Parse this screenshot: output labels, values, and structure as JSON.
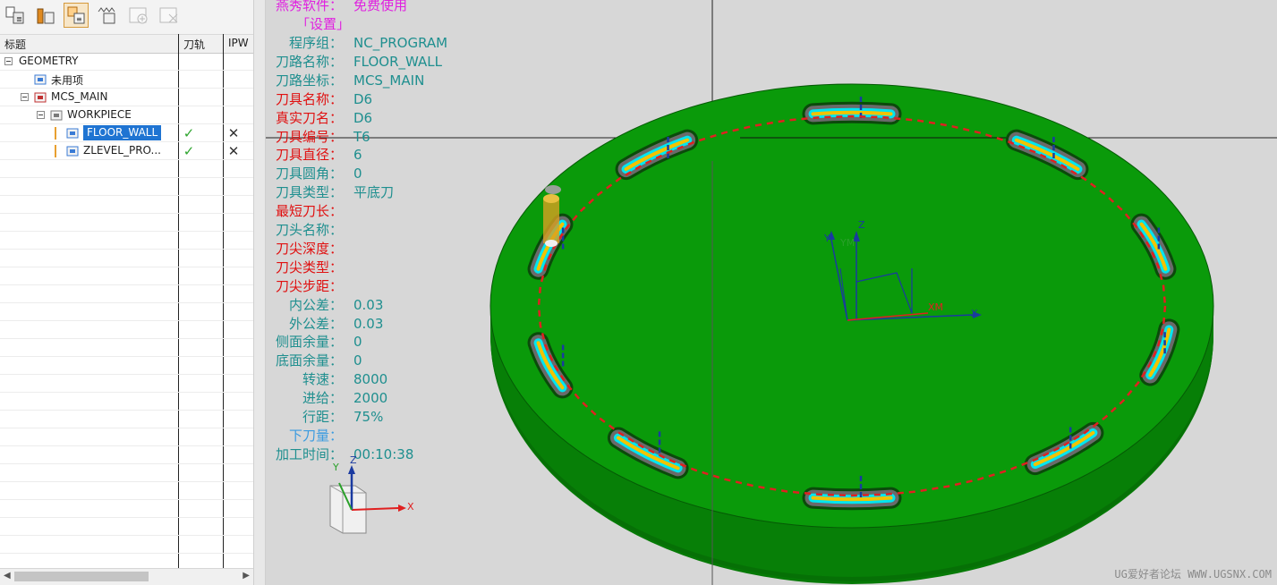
{
  "navigator": {
    "toolbar": [
      {
        "name": "program-order-view-button",
        "icon": "program-order-icon"
      },
      {
        "name": "machine-tool-view-button",
        "icon": "machine-tool-icon"
      },
      {
        "name": "geometry-view-button",
        "icon": "geometry-view-icon",
        "active": true
      },
      {
        "name": "machining-method-view-button",
        "icon": "machining-method-icon"
      },
      {
        "name": "add-object-button",
        "icon": "add-object-icon",
        "disabled": true
      },
      {
        "name": "delete-object-button",
        "icon": "delete-object-icon",
        "disabled": true
      }
    ],
    "columns": {
      "name": "标题",
      "toolpath": "刀轨",
      "ipw": "IPW"
    },
    "tree": [
      {
        "label": "GEOMETRY",
        "level": 0,
        "expander": true
      },
      {
        "label": "未用项",
        "level": 1
      },
      {
        "label": "MCS_MAIN",
        "level": 1,
        "expander": true
      },
      {
        "label": "WORKPIECE",
        "level": 2,
        "expander": true
      },
      {
        "label": "FLOOR_WALL",
        "level": 3,
        "selected": true,
        "toolpath": "✓",
        "ipw": "✕"
      },
      {
        "label": "ZLEVEL_PRO...",
        "level": 3,
        "toolpath": "✓",
        "ipw": "✕"
      }
    ]
  },
  "viewport": {
    "header": {
      "key": "燕秀软件：",
      "value": "免费使用"
    },
    "settings_label": "「设置」",
    "params": [
      {
        "key": "程序组：",
        "value": "NC_PROGRAM",
        "color": "#1f8f8f"
      },
      {
        "key": "刀路名称：",
        "value": "FLOOR_WALL",
        "color": "#1f8f8f"
      },
      {
        "key": "刀路坐标：",
        "value": "MCS_MAIN",
        "color": "#1f8f8f"
      },
      {
        "key": "刀具名称：",
        "value": "D6",
        "color": "#e01010"
      },
      {
        "key": "真实刀名：",
        "value": "D6",
        "color": "#e01010"
      },
      {
        "key": "刀具编号：",
        "value": "T6",
        "color": "#e01010"
      },
      {
        "key": "刀具直径：",
        "value": "6",
        "color": "#e01010"
      },
      {
        "key": "刀具圆角：",
        "value": "0",
        "color": "#1f8f8f"
      },
      {
        "key": "刀具类型：",
        "value": "平底刀",
        "color": "#1f8f8f"
      },
      {
        "key": "最短刀长：",
        "value": "",
        "color": "#e01010"
      },
      {
        "key": "刀头名称：",
        "value": "",
        "color": "#1f8f8f"
      },
      {
        "key": "刀尖深度：",
        "value": "",
        "color": "#e01010"
      },
      {
        "key": "刀尖类型：",
        "value": "",
        "color": "#e01010"
      },
      {
        "key": "刀尖步距：",
        "value": "",
        "color": "#e01010"
      },
      {
        "key": "内公差：",
        "value": "0.03",
        "color": "#1f8f8f"
      },
      {
        "key": "外公差：",
        "value": "0.03",
        "color": "#1f8f8f"
      },
      {
        "key": "侧面余量：",
        "value": "0",
        "color": "#1f8f8f"
      },
      {
        "key": "底面余量：",
        "value": "0",
        "color": "#1f8f8f"
      },
      {
        "key": "转速：",
        "value": "8000",
        "color": "#1f8f8f"
      },
      {
        "key": "进给：",
        "value": "2000",
        "color": "#1f8f8f"
      },
      {
        "key": "行距：",
        "value": "75%",
        "color": "#1f8f8f"
      },
      {
        "key": "下刀量：",
        "value": "",
        "color": "#3a9be0"
      },
      {
        "key": "加工时间：",
        "value": "00:10:38",
        "color": "#1f8f8f"
      }
    ],
    "triad": {
      "x": "X",
      "y": "Y",
      "z": "Z"
    },
    "wcs": {
      "x": "X",
      "y": "Y",
      "z": "Z",
      "xm": "XM",
      "ym": "YM"
    },
    "watermark": "UG爱好者论坛 WWW.UGSNX.COM",
    "colors": {
      "plate": "#0a9a0a",
      "plate_edge": "#077a07",
      "cyan": "#00e5f0",
      "yellow": "#f2c200",
      "path": "#e02020"
    }
  }
}
